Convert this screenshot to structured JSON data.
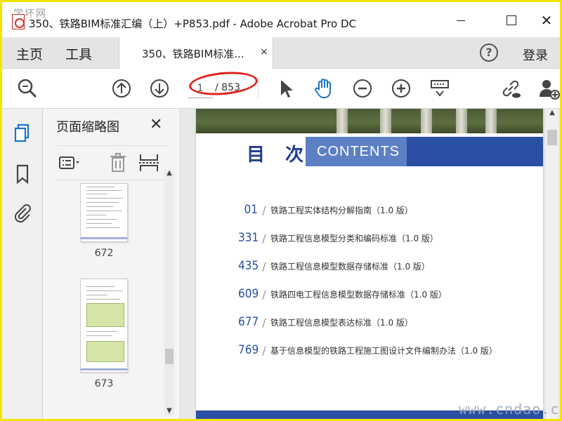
{
  "window": {
    "title": "350、铁路BIM标准汇编（上）+P853.pdf - Adobe Acrobat Pro DC",
    "watermark_top": "学坏网",
    "close_glyph": "✕"
  },
  "menu": {
    "home": "主页",
    "tools": "工具",
    "login": "登录",
    "help_glyph": "?"
  },
  "tab": {
    "label": "350、铁路BIM标准...",
    "close_glyph": "×"
  },
  "toolbar": {
    "current_page": "1",
    "total_pages": "/ 853",
    "icons": [
      "zoom-search-icon",
      "page-up-icon",
      "page-down-icon",
      "select-arrow-icon",
      "hand-tool-icon",
      "zoom-out-icon",
      "zoom-in-icon",
      "scroll-mode-icon",
      "share-link-icon",
      "add-user-icon"
    ]
  },
  "leftnav": {
    "icons": [
      "page-thumbnails-icon",
      "bookmark-icon",
      "attachment-icon"
    ]
  },
  "thumbnail_panel": {
    "title": "页面缩略图",
    "close_glyph": "✕",
    "thumbnails": [
      {
        "page": "672"
      },
      {
        "page": "673"
      }
    ]
  },
  "document": {
    "heading_cn": "目 次",
    "heading_en": "CONTENTS",
    "toc": [
      {
        "page": "01",
        "title": "铁路工程实体结构分解指南（1.0 版）"
      },
      {
        "page": "331",
        "title": "铁路工程信息模型分类和编码标准（1.0 版）"
      },
      {
        "page": "435",
        "title": "铁路工程信息模型数据存储标准（1.0 版）"
      },
      {
        "page": "609",
        "title": "铁路四电工程信息模型数据存储标准（1.0 版）"
      },
      {
        "page": "677",
        "title": "铁路工程信息模型表达标准（1.0 版）"
      },
      {
        "page": "769",
        "title": "基于信息模型的铁路工程施工图设计文件编制办法（1.0 版）"
      }
    ]
  },
  "watermark_bottom": "www.cndao.com",
  "colors": {
    "frame": "#f2e600",
    "accent_blue": "#2a4fa3",
    "annotation_red": "#e0221b"
  }
}
